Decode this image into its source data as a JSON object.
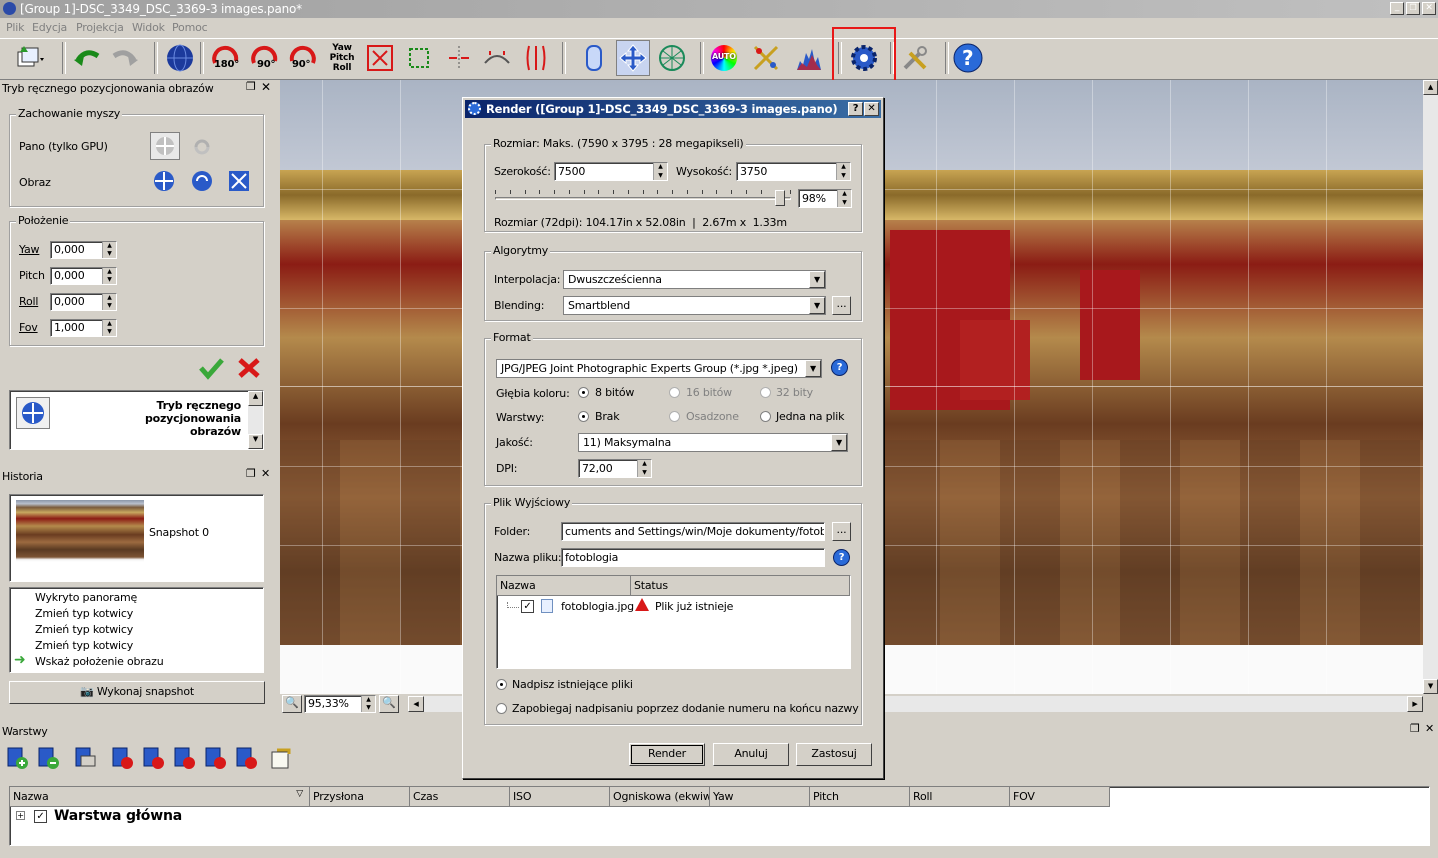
{
  "window": {
    "title": "[Group 1]-DSC_3349_DSC_3369-3 images.pano*"
  },
  "menu": [
    "Plik",
    "Edycja",
    "Projekcja",
    "Widok",
    "Pomoc"
  ],
  "toolbar": {
    "rotate180": "180°",
    "rotate90cw": "90°",
    "rotate90ccw": "90°",
    "ypr": "Yaw\nPitch\nRoll",
    "auto": "AUTO"
  },
  "left_panel": {
    "title": "Tryb ręcznego pozycjonowania obrazów",
    "mouse_group": "Zachowanie myszy",
    "pano_label": "Pano (tylko GPU)",
    "image_label": "Obraz",
    "position_group": "Położenie",
    "fields": [
      {
        "label": "Yaw",
        "value": "0,000"
      },
      {
        "label": "Pitch",
        "value": "0,000"
      },
      {
        "label": "Roll",
        "value": "0,000"
      },
      {
        "label": "Fov",
        "value": "1,000"
      }
    ],
    "mode_text": "Tryb ręcznego pozycjonowania obrazów"
  },
  "history": {
    "title": "Historia",
    "snapshot_label": "Snapshot 0",
    "items": [
      "Wykryto panoramę",
      "Zmień typ kotwicy",
      "Zmień typ kotwicy",
      "Zmień typ kotwicy",
      "Wskaż położenie obrazu"
    ],
    "snapshot_button": "Wykonaj snapshot"
  },
  "viewer": {
    "zoom": "95,33%"
  },
  "layers": {
    "title": "Warstwy",
    "columns": [
      "Nazwa",
      "Przysłona",
      "Czas",
      "ISO",
      "Ogniskowa (ekwiwa",
      "Yaw",
      "Pitch",
      "Roll",
      "FOV"
    ],
    "main_layer": "Warstwa główna"
  },
  "dialog": {
    "title": "Render ([Group 1]-DSC_3349_DSC_3369-3 images.pano)",
    "help": "?",
    "size_group": "Rozmiar: Maks. (7590 x 3795 : 28 megapikseli)",
    "width_label": "Szerokość:",
    "width_value": "7500",
    "height_label": "Wysokość:",
    "height_value": "3750",
    "percent": "98%",
    "percent_value": 98,
    "size_info": "Rozmiar (72dpi): 104.17in x 52.08in  |  2.67m x  1.33m",
    "algo_group": "Algorytmy",
    "interp_label": "Interpolacja:",
    "interp_value": "Dwuszcześcienna",
    "blend_label": "Blending:",
    "blend_value": "Smartblend",
    "more": "...",
    "format_group": "Format",
    "format_value": "JPG/JPEG Joint Photographic Experts Group (*.jpg *.jpeg)",
    "depth_label": "Głębia koloru:",
    "depth_options": [
      "8 bitów",
      "16 bitów",
      "32 bity"
    ],
    "layers_label": "Warstwy:",
    "layers_options": [
      "Brak",
      "Osadzone",
      "Jedna na plik"
    ],
    "quality_label": "Jakość:",
    "quality_value": "11) Maksymalna",
    "dpi_label": "DPI:",
    "dpi_value": "72,00",
    "output_group": "Plik Wyjściowy",
    "folder_label": "Folder:",
    "folder_value": "cuments and Settings/win/Moje dokumenty/fotoblogia",
    "filename_label": "Nazwa pliku:",
    "filename_value": "fotoblogia",
    "col_name": "Nazwa",
    "col_status": "Status",
    "file_name": "fotoblogia.jpg",
    "file_status": "Plik już istnieje",
    "overwrite": "Nadpisz istniejące pliki",
    "prevent": "Zapobiegaj nadpisaniu poprzez dodanie numeru na końcu nazwy",
    "render_btn": "Render",
    "cancel_btn": "Anuluj",
    "apply_btn": "Zastosuj"
  },
  "colors": {
    "titlebar": "#0a246a",
    "highlight": "#e81818"
  }
}
